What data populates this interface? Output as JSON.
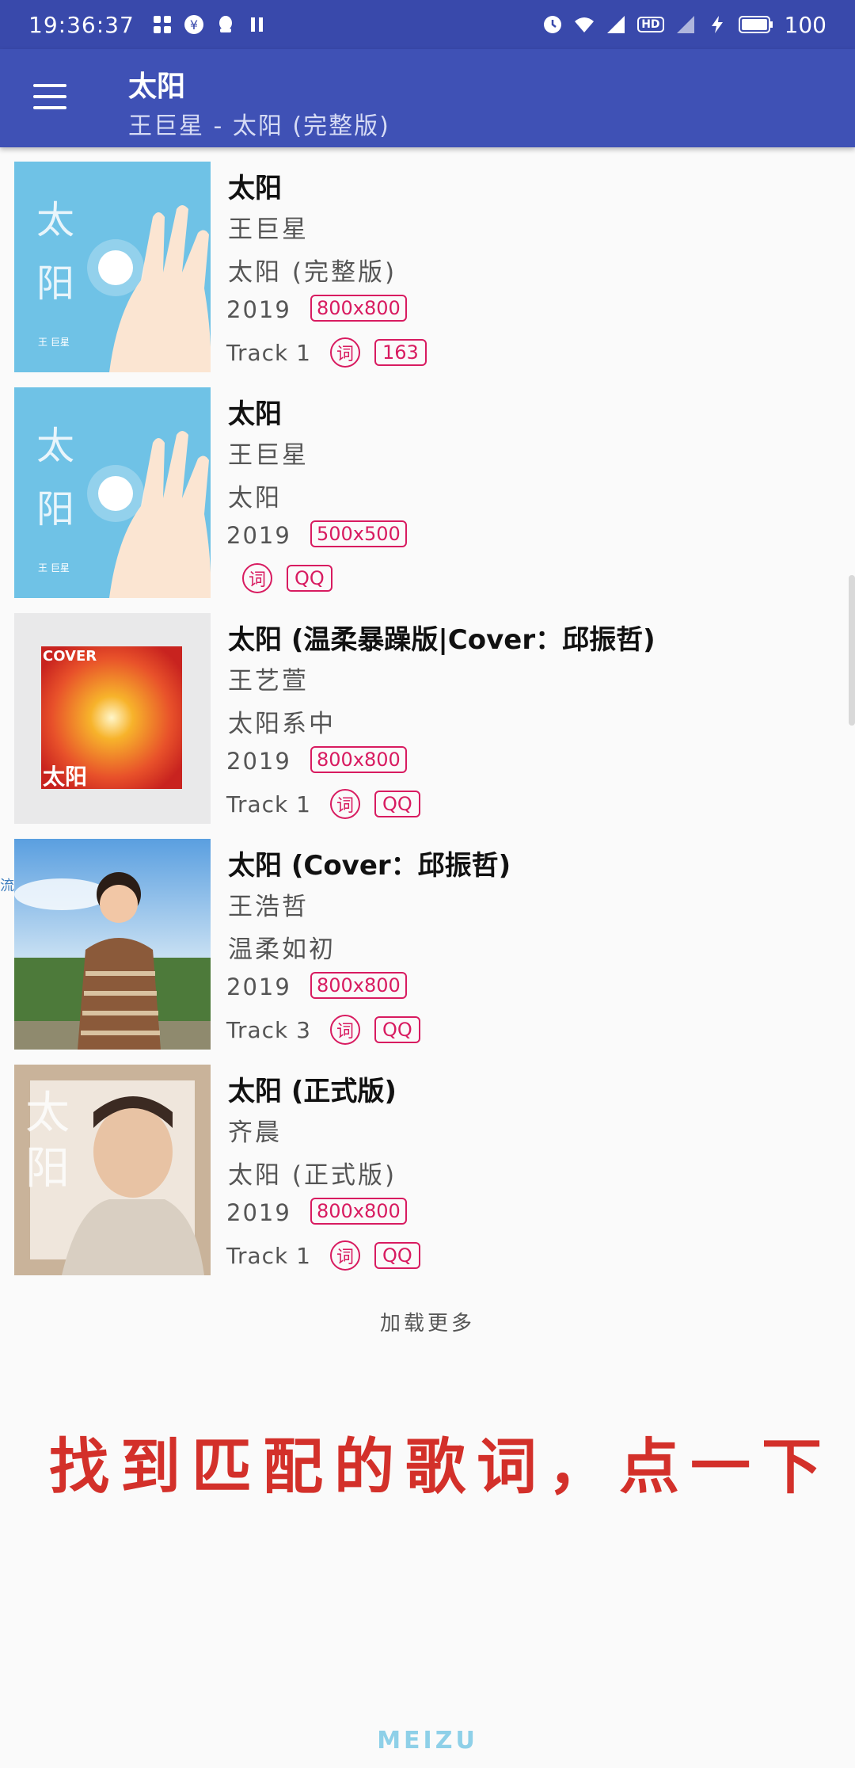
{
  "status_bar": {
    "time": "19:36:37",
    "battery": "100",
    "network_badge": "HD"
  },
  "app_bar": {
    "title": "太阳",
    "subtitle": "王巨星 - 太阳 (完整版)",
    "menu_icon": "menu-icon"
  },
  "results": [
    {
      "title": "太阳",
      "artist": "王巨星",
      "album": "太阳 (完整版)",
      "year": "2019",
      "size": "800x800",
      "track": "Track 1",
      "lyric_badge": "词",
      "source": "163",
      "cover": {
        "bg": "#6fc2e6",
        "accent": "#ffffff",
        "text": "太阳"
      }
    },
    {
      "title": "太阳",
      "artist": "王巨星",
      "album": "太阳",
      "year": "2019",
      "size": "500x500",
      "track": "",
      "lyric_badge": "词",
      "source": "QQ",
      "cover": {
        "bg": "#6fc2e6",
        "accent": "#ffffff",
        "text": "太阳"
      }
    },
    {
      "title": "太阳 (温柔暴躁版|Cover：邱振哲)",
      "artist": "王艺萱",
      "album": "太阳系中",
      "year": "2019",
      "size": "800x800",
      "track": "Track 1",
      "lyric_badge": "词",
      "source": "QQ",
      "cover": {
        "bg": "#e9e9ea",
        "accent": "#e8512a",
        "text": "太阳",
        "label": "COVER"
      }
    },
    {
      "title": "太阳 (Cover：邱振哲)",
      "artist": "王浩哲",
      "album": "温柔如初",
      "year": "2019",
      "size": "800x800",
      "track": "Track 3",
      "lyric_badge": "词",
      "source": "QQ",
      "cover": {
        "bg": "#7fb6e6",
        "accent": "#8b5a3a"
      }
    },
    {
      "title": "太阳 (正式版)",
      "artist": "齐晨",
      "album": "太阳 (正式版)",
      "year": "2019",
      "size": "800x800",
      "track": "Track 1",
      "lyric_badge": "词",
      "source": "QQ",
      "cover": {
        "bg": "#c9b39a",
        "accent": "#efe6dc",
        "text": "太阳"
      }
    }
  ],
  "load_more": "加载更多",
  "annotation": "找到匹配的歌词，点一下",
  "brand": "MEIZU",
  "colors": {
    "status_bar": "#3949ab",
    "app_bar": "#3f51b5",
    "badge": "#d81b60",
    "annotation": "#d3302a"
  }
}
